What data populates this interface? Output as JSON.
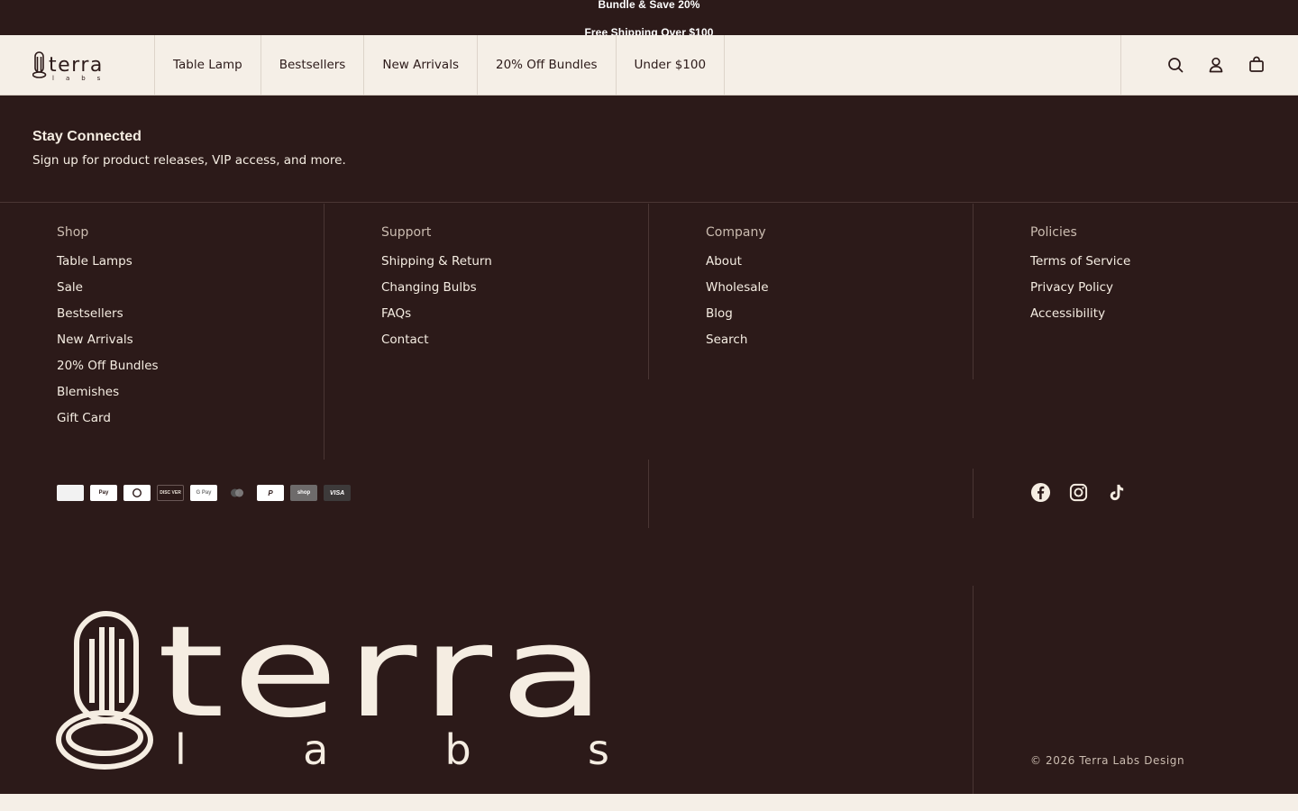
{
  "announcement": {
    "line1": "Bundle & Save 20%",
    "line2": "Free Shipping Over $100"
  },
  "header": {
    "logo_alt": "terra labs",
    "nav": [
      "Table Lamp",
      "Bestsellers",
      "New Arrivals",
      "20% Off Bundles",
      "Under $100"
    ],
    "icons": [
      "search-icon",
      "account-icon",
      "cart-icon"
    ]
  },
  "newsletter": {
    "title": "Stay Connected",
    "subtitle": "Sign up for product releases, VIP access, and more."
  },
  "footer": {
    "columns": [
      {
        "title": "Shop",
        "links": [
          "Table Lamps",
          "Sale",
          "Bestsellers",
          "New Arrivals",
          "20% Off Bundles",
          "Blemishes",
          "Gift Card"
        ]
      },
      {
        "title": "Support",
        "links": [
          "Shipping & Return",
          "Changing Bulbs",
          "FAQs",
          "Contact"
        ]
      },
      {
        "title": "Company",
        "links": [
          "About",
          "Wholesale",
          "Blog",
          "Search"
        ]
      },
      {
        "title": "Policies",
        "links": [
          "Terms of Service",
          "Privacy Policy",
          "Accessibility"
        ]
      }
    ],
    "payments": [
      "American Express",
      "Apple Pay",
      "Diners Club",
      "Discover",
      "Google Pay",
      "Mastercard",
      "PayPal",
      "Shop Pay",
      "Visa"
    ],
    "payment_labels": {
      "applepay": "Pay",
      "discover": "DISC VER",
      "gpay": "G Pay",
      "paypal": "P",
      "shop": "shop",
      "visa": "VISA"
    },
    "social": [
      "facebook-icon",
      "instagram-icon",
      "tiktok-icon"
    ],
    "logo_word": "terra",
    "logo_sub": "l a b s",
    "copyright": "© 2026 Terra Labs Design"
  },
  "colors": {
    "background": "#2c1a19",
    "header_bg": "#f5efe7",
    "text_light": "#f5ede2",
    "text_muted": "#cbbcb0"
  }
}
